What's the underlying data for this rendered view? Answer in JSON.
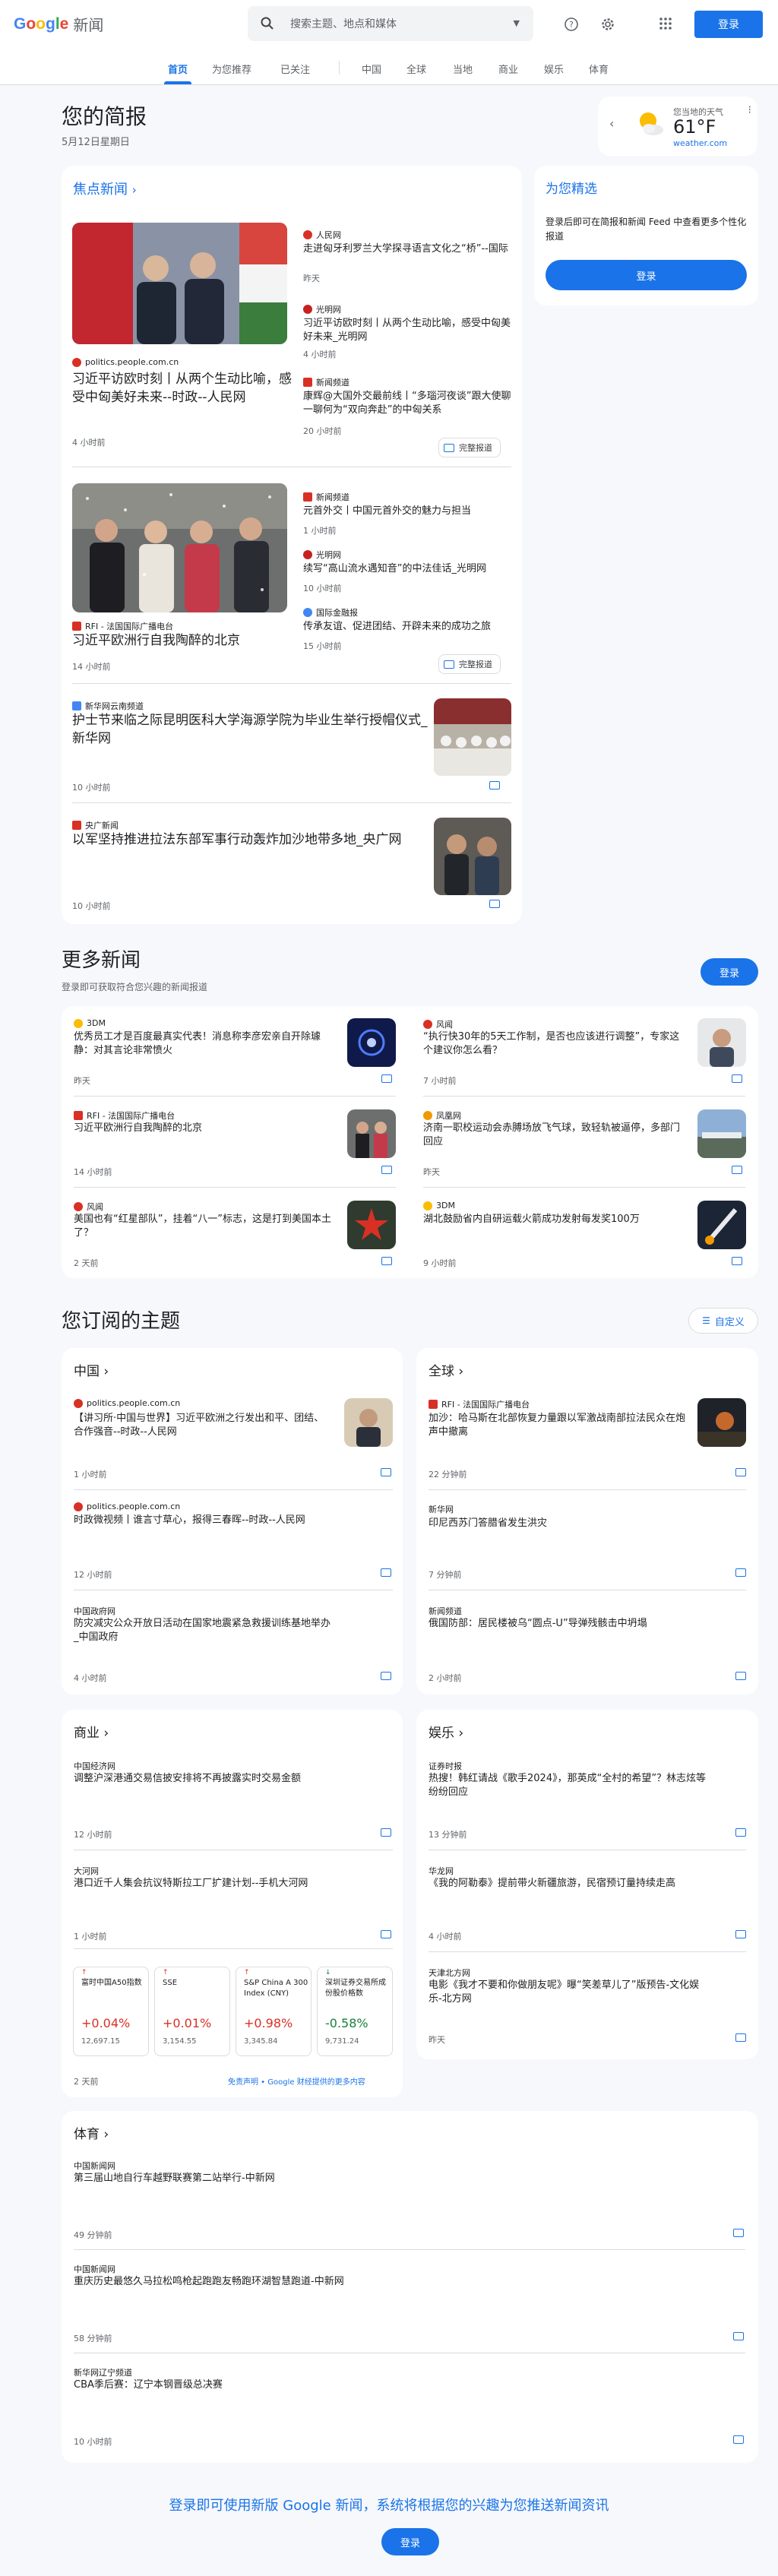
{
  "header": {
    "logo_google": "Google",
    "logo_product": "新闻",
    "search_placeholder": "搜索主题、地点和媒体",
    "signin_label": "登录"
  },
  "nav": {
    "tabs": [
      "首页",
      "为您推荐",
      "已关注",
      "中国",
      "全球",
      "当地",
      "商业",
      "娱乐",
      "体育"
    ]
  },
  "briefing": {
    "title": "您的简报",
    "date": "5月12日星期日",
    "weather_label": "您当地的天气",
    "weather_temp": "61°F",
    "weather_source": "weather.com"
  },
  "top_stories": {
    "title": "焦点新闻",
    "clusters": [
      {
        "main_source": "politics.people.com.cn",
        "main_headline": "习近平访欧时刻丨从两个生动比喻，感受中匈美好未来--时政--人民网",
        "main_time": "4 小时前",
        "side": [
          {
            "source": "人民网",
            "headline": "走进匈牙利罗兰大学探寻语言文化之“桥”--国际",
            "time": "昨天"
          },
          {
            "source": "光明网",
            "headline": "习近平访欧时刻丨从两个生动比喻，感受中匈美好未来_光明网",
            "time": "4 小时前"
          },
          {
            "source": "新闻频道",
            "headline": "康辉@大国外交最前线丨“多瑙河夜谈”跟大使聊一聊何为“双向奔赴”的中匈关系",
            "time": "20 小时前"
          }
        ],
        "full_coverage": "完整报道"
      },
      {
        "main_source": "RFI - 法国国际广播电台",
        "main_headline": "习近平欧洲行自我陶醉的北京",
        "main_time": "14 小时前",
        "side": [
          {
            "source": "新闻频道",
            "headline": "元首外交丨中国元首外交的魅力与担当",
            "time": "1 小时前"
          },
          {
            "source": "光明网",
            "headline": "续写“高山流水遇知音”的中法佳话_光明网",
            "time": "10 小时前"
          },
          {
            "source": "国际金融报",
            "headline": "传承友谊、促进团结、开辟未来的成功之旅",
            "time": "15 小时前"
          }
        ],
        "full_coverage": "完整报道"
      }
    ],
    "singles": [
      {
        "source": "新华网云南频道",
        "headline": "护士节来临之际昆明医科大学海源学院为毕业生举行授帽仪式_新华网",
        "time": "10 小时前"
      },
      {
        "source": "央广新闻",
        "headline": "以军坚持推进拉法东部军事行动轰炸加沙地带多地_央广网",
        "time": "10 小时前"
      }
    ]
  },
  "picks": {
    "title": "为您精选",
    "desc": "登录后即可在简报和新闻 Feed 中查看更多个性化报道",
    "button": "登录"
  },
  "more_news": {
    "title": "更多新闻",
    "subtitle": "登录即可获取符合您兴趣的新闻报道",
    "button": "登录",
    "items": [
      {
        "source": "3DM",
        "headline": "优秀员工才是百度最真实代表！消息称李彦宏亲自开除璩静：对其言论非常愤火",
        "time": "昨天"
      },
      {
        "source": "风闻",
        "headline": "“执行快30年的5天工作制，是否也应该进行调整”，专家这个建议你怎么看？",
        "time": "7 小时前"
      },
      {
        "source": "RFI - 法国国际广播电台",
        "headline": "习近平欧洲行自我陶醉的北京",
        "time": "14 小时前"
      },
      {
        "source": "凤凰网",
        "headline": "济南一职校运动会赤膊场放飞气球，致轻轨被逼停，多部门回应",
        "time": "昨天"
      },
      {
        "source": "风闻",
        "headline": "美国也有“红星部队”，挂着“八一”标志，这是打到美国本土了？",
        "time": "2 天前"
      },
      {
        "source": "3DM",
        "headline": "湖北鼓励省内自研运载火箭成功发射每发奖100万",
        "time": "9 小时前"
      }
    ]
  },
  "topics": {
    "title": "您订阅的主题",
    "customize": "自定义",
    "china": {
      "title": "中国",
      "items": [
        {
          "source": "politics.people.com.cn",
          "headline": "【讲习所·中国与世界】习近平欧洲之行发出和平、团结、合作强音--时政--人民网",
          "time": "1 小时前"
        },
        {
          "source": "politics.people.com.cn",
          "headline": "时政微视频丨谁言寸草心，报得三春晖--时政--人民网",
          "time": "12 小时前"
        },
        {
          "source": "中国政府网",
          "headline": "防灾减灾公众开放日活动在国家地震紧急救援训练基地举办_中国政府",
          "time": "4 小时前"
        }
      ]
    },
    "world": {
      "title": "全球",
      "items": [
        {
          "source": "RFI - 法国国际广播电台",
          "headline": "加沙：哈马斯在北部恢复力量跟以军激战南部拉法民众在炮声中撤离",
          "time": "22 分钟前"
        },
        {
          "source": "新华网",
          "headline": "印尼西苏门答腊省发生洪灾",
          "time": "7 分钟前"
        },
        {
          "source": "新闻频道",
          "headline": "俄国防部：居民楼被乌“圆点-U”导弹残骸击中坍塌",
          "time": "2 小时前"
        }
      ]
    },
    "business": {
      "title": "商业",
      "items": [
        {
          "source": "中国经济网",
          "headline": "调整沪深港通交易信披安排将不再披露实时交易金额",
          "time": "12 小时前"
        },
        {
          "source": "大河网",
          "headline": "港口近千人集会抗议特斯拉工厂扩建计划--手机大河网",
          "time": "1 小时前"
        }
      ],
      "stocks": [
        {
          "name": "富时中国A50指数",
          "change": "+0.04%",
          "price": "12,697.15",
          "color": "#d93025"
        },
        {
          "name": "SSE",
          "change": "+0.01%",
          "price": "3,154.55",
          "color": "#d93025"
        },
        {
          "name": "S&P China A 300 Index (CNY)",
          "change": "+0.98%",
          "price": "3,345.84",
          "color": "#d93025"
        },
        {
          "name": "深圳证券交易所成份股价格数",
          "change": "-0.58%",
          "price": "9,731.24",
          "color": "#188038"
        }
      ],
      "time": "2 天前",
      "disclaimer": "免责声明 • Google 财经提供的更多内容"
    },
    "entertainment": {
      "title": "娱乐",
      "items": [
        {
          "source": "证券时报",
          "headline": "热搜！韩红请战《歌手2024》，那英成“全村的希望”？林志炫等纷纷回应",
          "time": "13 分钟前"
        },
        {
          "source": "华龙网",
          "headline": "《我的阿勒泰》提前带火新疆旅游，民宿预订量持续走高",
          "time": "4 小时前"
        },
        {
          "source": "天津北方网",
          "headline": "电影《我才不要和你做朋友呢》曝“笑差草儿了”版预告-文化娱乐-北方网",
          "time": "昨天"
        }
      ]
    },
    "sports": {
      "title": "体育",
      "items": [
        {
          "source": "中国新闻网",
          "headline": "第三届山地自行车越野联赛第二站举行-中新网",
          "time": "49 分钟前"
        },
        {
          "source": "中国新闻网",
          "headline": "重庆历史最悠久马拉松鸣枪起跑跑友畅跑环湖智慧跑道-中新网",
          "time": "58 分钟前"
        },
        {
          "source": "新华网辽宁频道",
          "headline": "CBA季后赛：辽宁本钢晋级总决赛",
          "time": "10 小时前"
        }
      ]
    }
  },
  "footer": {
    "text": "登录即可使用新版 Google 新闻，系统将根据您的兴趣为您推送新闻资讯",
    "button": "登录"
  },
  "colors": {
    "accent": "#1a73e8",
    "up": "#d93025",
    "down": "#188038"
  }
}
